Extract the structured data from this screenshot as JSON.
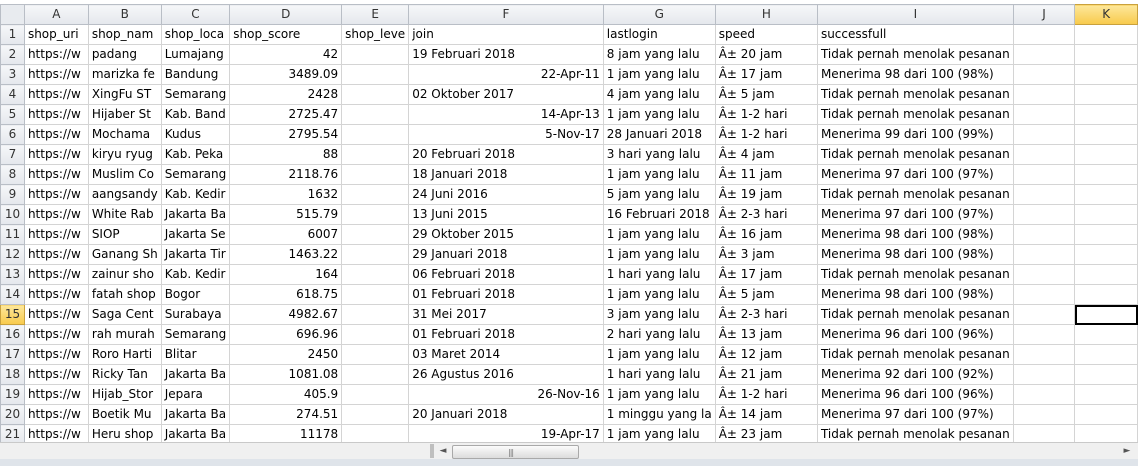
{
  "columns": [
    "A",
    "B",
    "C",
    "D",
    "E",
    "F",
    "G",
    "H",
    "I",
    "J",
    "K"
  ],
  "selected_column": "K",
  "selected_row": "15",
  "rows": [
    {
      "n": "1",
      "A": "shop_uri",
      "B": "shop_nam",
      "C": "shop_loca",
      "D": "shop_score",
      "E": "shop_leve",
      "F": "join",
      "F_align": "left",
      "G": "lastlogin",
      "H": "speed",
      "I": "successfull"
    },
    {
      "n": "2",
      "A": "https://w",
      "B": "padang",
      "C": "Lumajang",
      "D": "42",
      "E": "",
      "F": "19 Februari 2018",
      "F_align": "left",
      "G": "8 jam yang lalu",
      "H": "Â± 20 jam",
      "I": "Tidak pernah menolak pesanan"
    },
    {
      "n": "3",
      "A": "https://w",
      "B": "marizka fe",
      "C": "Bandung",
      "D": "3489.09",
      "E": "",
      "F": "22-Apr-11",
      "F_align": "right",
      "G": "1 jam yang lalu",
      "H": "Â± 17 jam",
      "I": "Menerima 98 dari 100 (98%)"
    },
    {
      "n": "4",
      "A": "https://w",
      "B": "XingFu ST",
      "C": "Semarang",
      "D": "2428",
      "E": "",
      "F": "02 Oktober 2017",
      "F_align": "left",
      "G": "4 jam yang lalu",
      "H": "Â± 5 jam",
      "I": "Tidak pernah menolak pesanan"
    },
    {
      "n": "5",
      "A": "https://w",
      "B": "Hijaber St",
      "C": "Kab. Band",
      "D": "2725.47",
      "E": "",
      "F": "14-Apr-13",
      "F_align": "right",
      "G": "1 jam yang lalu",
      "H": "Â± 1-2 hari",
      "I": "Tidak pernah menolak pesanan"
    },
    {
      "n": "6",
      "A": "https://w",
      "B": "Mochama",
      "C": "Kudus",
      "D": "2795.54",
      "E": "",
      "F": "5-Nov-17",
      "F_align": "right",
      "G": "28 Januari 2018",
      "H": "Â± 1-2 hari",
      "I": "Menerima 99 dari 100 (99%)"
    },
    {
      "n": "7",
      "A": "https://w",
      "B": "kiryu ryug",
      "C": "Kab. Peka",
      "D": "88",
      "E": "",
      "F": "20 Februari 2018",
      "F_align": "left",
      "G": "3 hari yang lalu",
      "H": "Â± 4 jam",
      "I": "Tidak pernah menolak pesanan"
    },
    {
      "n": "8",
      "A": "https://w",
      "B": "Muslim Co",
      "C": "Semarang",
      "D": "2118.76",
      "E": "",
      "F": "18 Januari 2018",
      "F_align": "left",
      "G": "1 jam yang lalu",
      "H": "Â± 11 jam",
      "I": "Menerima 97 dari 100 (97%)"
    },
    {
      "n": "9",
      "A": "https://w",
      "B": "aangsandy",
      "C": "Kab. Kedir",
      "D": "1632",
      "E": "",
      "F": "24 Juni 2016",
      "F_align": "left",
      "G": "5 jam yang lalu",
      "H": "Â± 19 jam",
      "I": "Tidak pernah menolak pesanan"
    },
    {
      "n": "10",
      "A": "https://w",
      "B": "White Rab",
      "C": "Jakarta Ba",
      "D": "515.79",
      "E": "",
      "F": "13 Juni 2015",
      "F_align": "left",
      "G": "16 Februari 2018",
      "H": "Â± 2-3 hari",
      "I": "Menerima 97 dari 100 (97%)"
    },
    {
      "n": "11",
      "A": "https://w",
      "B": "SIOP",
      "C": "Jakarta Se",
      "D": "6007",
      "E": "",
      "F": "29 Oktober 2015",
      "F_align": "left",
      "G": "1 jam yang lalu",
      "H": "Â± 16 jam",
      "I": "Menerima 98 dari 100 (98%)"
    },
    {
      "n": "12",
      "A": "https://w",
      "B": "Ganang Sh",
      "C": "Jakarta Tir",
      "D": "1463.22",
      "E": "",
      "F": "29 Januari 2018",
      "F_align": "left",
      "G": "1 jam yang lalu",
      "H": "Â± 3 jam",
      "I": "Menerima 98 dari 100 (98%)"
    },
    {
      "n": "13",
      "A": "https://w",
      "B": "zainur sho",
      "C": "Kab. Kedir",
      "D": "164",
      "E": "",
      "F": "06 Februari 2018",
      "F_align": "left",
      "G": "1 hari yang lalu",
      "H": "Â± 17 jam",
      "I": "Tidak pernah menolak pesanan"
    },
    {
      "n": "14",
      "A": "https://w",
      "B": "fatah shop",
      "C": "Bogor",
      "D": "618.75",
      "E": "",
      "F": "01 Februari 2018",
      "F_align": "left",
      "G": "1 jam yang lalu",
      "H": "Â± 5 jam",
      "I": "Menerima 98 dari 100 (98%)"
    },
    {
      "n": "15",
      "A": "https://w",
      "B": "Saga Cent",
      "C": "Surabaya",
      "D": "4982.67",
      "E": "",
      "F": "31 Mei 2017",
      "F_align": "left",
      "G": "3 jam yang lalu",
      "H": "Â± 2-3 hari",
      "I": "Tidak pernah menolak pesanan"
    },
    {
      "n": "16",
      "A": "https://w",
      "B": "rah murah",
      "C": "Semarang",
      "D": "696.96",
      "E": "",
      "F": "01 Februari 2018",
      "F_align": "left",
      "G": "2 hari yang lalu",
      "H": "Â± 13 jam",
      "I": "Menerima 96 dari 100 (96%)"
    },
    {
      "n": "17",
      "A": "https://w",
      "B": "Roro Harti",
      "C": "Blitar",
      "D": "2450",
      "E": "",
      "F": "03 Maret 2014",
      "F_align": "left",
      "G": "1 jam yang lalu",
      "H": "Â± 12 jam",
      "I": "Tidak pernah menolak pesanan"
    },
    {
      "n": "18",
      "A": "https://w",
      "B": "Ricky Tan",
      "C": "Jakarta Ba",
      "D": "1081.08",
      "E": "",
      "F": "26 Agustus 2016",
      "F_align": "left",
      "G": "1 hari yang lalu",
      "H": "Â± 21 jam",
      "I": "Menerima 92 dari 100 (92%)"
    },
    {
      "n": "19",
      "A": "https://w",
      "B": "Hijab_Stor",
      "C": "Jepara",
      "D": "405.9",
      "E": "",
      "F": "26-Nov-16",
      "F_align": "right",
      "G": "1 jam yang lalu",
      "H": "Â± 1-2 hari",
      "I": "Menerima 96 dari 100 (96%)"
    },
    {
      "n": "20",
      "A": "https://w",
      "B": "Boetik Mu",
      "C": "Jakarta Ba",
      "D": "274.51",
      "E": "",
      "F": "20 Januari 2018",
      "F_align": "left",
      "G": "1 minggu yang la",
      "H": "Â± 14 jam",
      "I": "Menerima 97 dari 100 (97%)"
    },
    {
      "n": "21",
      "A": "https://w",
      "B": "Heru shop",
      "C": "Jakarta Ba",
      "D": "11178",
      "E": "",
      "F": "19-Apr-17",
      "F_align": "right",
      "G": "1 jam yang lalu",
      "H": "Â± 23 jam",
      "I": "Tidak pernah menolak pesanan"
    }
  ],
  "scrollbar": {
    "left_arrow": "◄",
    "right_arrow": "►",
    "grip": "|||"
  }
}
